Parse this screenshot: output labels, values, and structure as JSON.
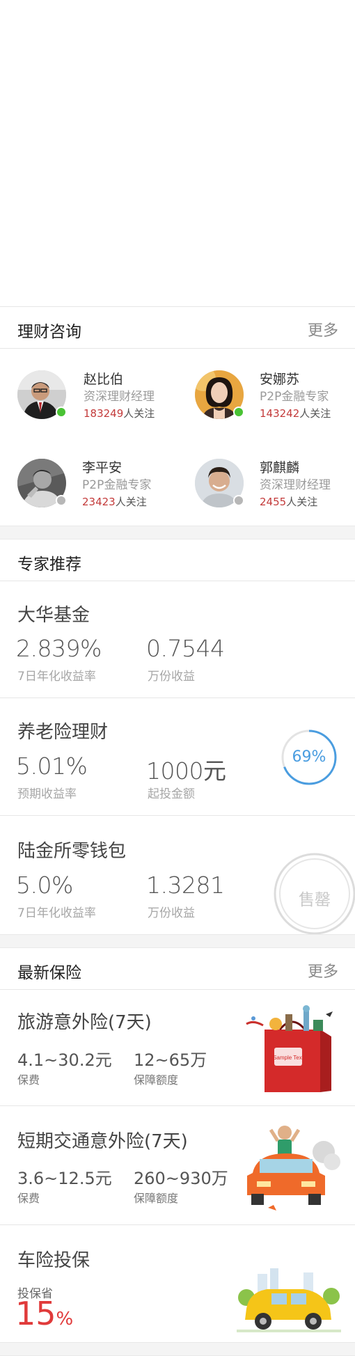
{
  "advisors_section": {
    "title": "理财咨询",
    "more": "更多",
    "advisors": [
      {
        "name": "赵比伯",
        "title": "资深理财经理",
        "followers": "183249",
        "follow_suffix": "人关注",
        "online": true
      },
      {
        "name": "安娜苏",
        "title": "P2P金融专家",
        "followers": "143242",
        "follow_suffix": "人关注",
        "online": true
      },
      {
        "name": "李平安",
        "title": "P2P金融专家",
        "followers": "23423",
        "follow_suffix": "人关注",
        "online": false
      },
      {
        "name": "郭麒麟",
        "title": "资深理财经理",
        "followers": "2455",
        "follow_suffix": "人关注",
        "online": false
      }
    ]
  },
  "experts_section": {
    "title": "专家推荐",
    "products": [
      {
        "name": "大华基金",
        "value1": "2.839%",
        "label1": "7日年化收益率",
        "value2": "0.7544",
        "label2": "万份收益"
      },
      {
        "name": "养老险理财",
        "value1": "5.01%",
        "label1": "预期收益率",
        "value2": "1000元",
        "label2": "起投金额",
        "progress_text": "69%",
        "progress": 0.69
      },
      {
        "name": "陆金所零钱包",
        "value1": "5.0%",
        "label1": "7日年化收益率",
        "value2": "1.3281",
        "label2": "万份收益",
        "stamp": "售罄"
      }
    ]
  },
  "insurance_section": {
    "title": "最新保险",
    "more": "更多",
    "items": [
      {
        "name": "旅游意外险(7天)",
        "value1": "4.1~30.2元",
        "label1": "保费",
        "value2": "12~65万",
        "label2": "保障额度",
        "bag_text": "Sample Text"
      },
      {
        "name": "短期交通意外险(7天)",
        "value1": "3.6~12.5元",
        "label1": "保费",
        "value2": "260~930万",
        "label2": "保障额度"
      },
      {
        "name": "车险投保",
        "label1": "投保省",
        "percent": "15",
        "percent_sign": "%"
      }
    ]
  },
  "colors": {
    "accent_blue": "#4a9de0",
    "highlight_red": "#e03a3a",
    "online_green": "#49c234"
  }
}
